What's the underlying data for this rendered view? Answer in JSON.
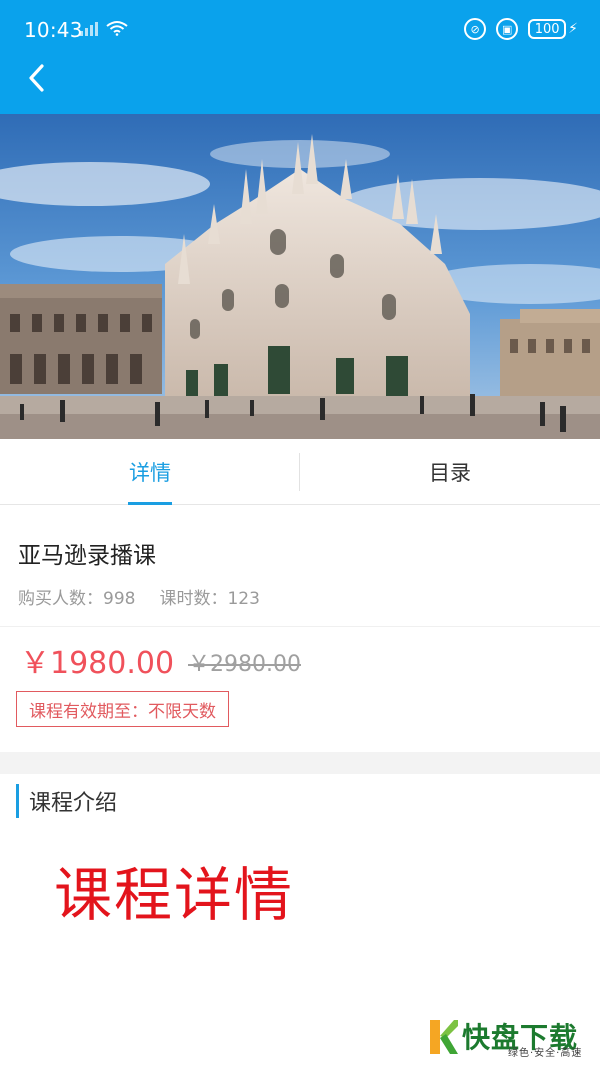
{
  "status": {
    "time": "10:43",
    "battery": "100"
  },
  "nav": {
    "back_icon": "chevron-left-icon"
  },
  "tabs": [
    {
      "label": "详情",
      "active": true
    },
    {
      "label": "目录",
      "active": false
    }
  ],
  "course": {
    "title": "亚马逊录播课",
    "buyers_label": "购买人数：998",
    "lessons_label": "课时数：123",
    "price": "￥1980.00",
    "original_price": "￥2980.00",
    "validity": "课程有效期至：不限天数"
  },
  "intro": {
    "heading": "课程介绍",
    "content": "课程详情"
  },
  "watermark": {
    "brand": "快盘下载",
    "tagline": "绿色·安全·高速"
  },
  "colors": {
    "header": "#0aa2ec",
    "accent": "#1a9ee2",
    "price": "#f0515b",
    "detail_red": "#e3141c"
  }
}
